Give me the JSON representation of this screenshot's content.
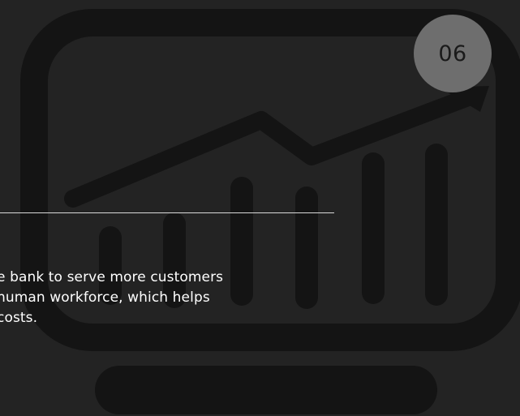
{
  "slide": {
    "badge_number": "06",
    "body_lines": [
      "e bank to serve more customers",
      " human workforce, which helps",
      "costs."
    ]
  },
  "illustration": {
    "icon": "monitor-growth-chart-icon",
    "color": "#141414"
  },
  "colors": {
    "background": "#232323",
    "badge": "#6e6e6e",
    "text": "#ffffff",
    "divider": "#d9d9d9"
  }
}
